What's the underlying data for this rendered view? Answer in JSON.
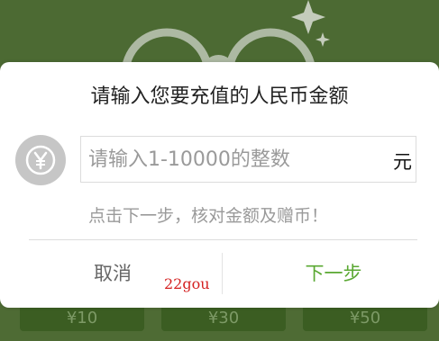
{
  "dialog": {
    "title": "请输入您要充值的人民币金额",
    "input_placeholder": "请输入1-10000的整数",
    "input_value": "",
    "unit": "元",
    "hint": "点击下一步，核对金额及赠币！",
    "cancel_label": "取消",
    "next_label": "下一步",
    "icon": "yen-coin-icon"
  },
  "background": {
    "amount_options": [
      "¥10",
      "¥30",
      "¥50"
    ]
  },
  "watermark": "22gou",
  "colors": {
    "accent_green": "#5aa832",
    "background_green": "#4c6a33",
    "hint_gray": "#9a9a9a"
  }
}
